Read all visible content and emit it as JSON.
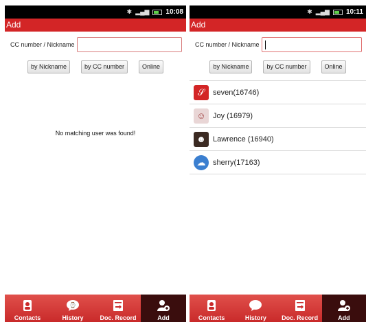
{
  "left": {
    "status_time": "10:08",
    "title": "Add",
    "search_label": "CC number / Nickname",
    "search_value": "",
    "buttons": [
      "by Nickname",
      "by CC number",
      "Online"
    ],
    "empty_message": "No matching user was found!",
    "tabs": [
      "Contacts",
      "History",
      "Doc. Record",
      "Add"
    ]
  },
  "right": {
    "status_time": "10:11",
    "title": "Add",
    "search_label": "CC number / Nickname",
    "search_value": "",
    "buttons": [
      "by Nickname",
      "by CC number",
      "Online"
    ],
    "results": [
      {
        "name": "seven(16746)",
        "avatar_color": "#d32526"
      },
      {
        "name": "Joy (16979)",
        "avatar_color": "#c9a0a0"
      },
      {
        "name": "Lawrence (16940)",
        "avatar_color": "#3b2a22"
      },
      {
        "name": "sherry(17163)",
        "avatar_color": "#3b7fd0"
      }
    ],
    "tabs": [
      "Contacts",
      "History",
      "Doc. Record",
      "Add"
    ]
  },
  "colors": {
    "accent": "#d32526",
    "active_tab": "#3a0d0d"
  },
  "icons": [
    "bluetooth-icon",
    "signal-icon",
    "battery-icon",
    "contacts-icon",
    "history-icon",
    "doc-record-icon",
    "add-user-icon"
  ]
}
